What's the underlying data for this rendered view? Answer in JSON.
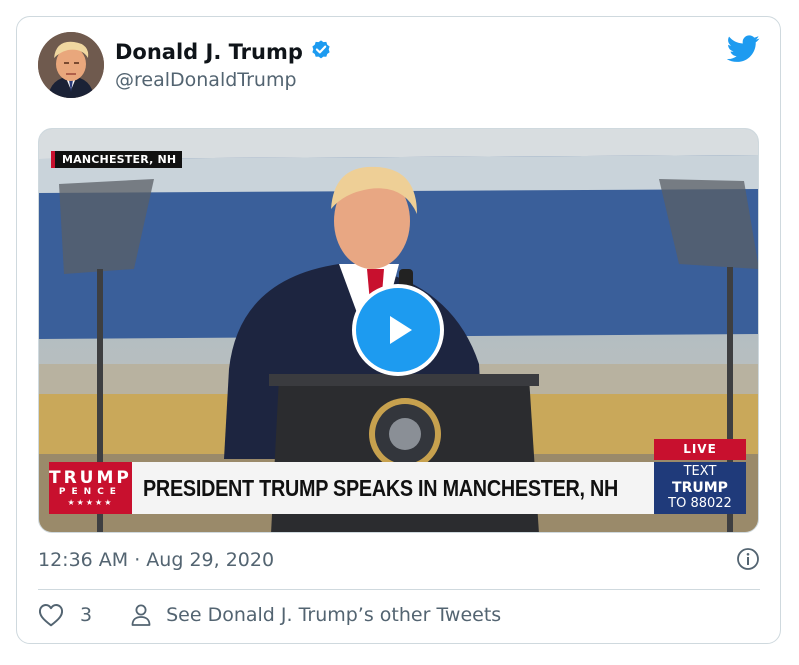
{
  "tweet": {
    "author_name": "Donald J. Trump",
    "handle": "@realDonaldTrump",
    "timestamp": "12:36 AM · Aug 29, 2020",
    "like_count": "3",
    "see_other_label": "See Donald J. Trump’s other Tweets",
    "colors": {
      "accent": "#1d9bf0",
      "muted": "#536471",
      "border": "#cfd9de"
    }
  },
  "video": {
    "location_tag": "MANCHESTER, NH",
    "brand_line1": "TRUMP",
    "brand_line2": "PENCE",
    "brand_line3": "★★★★★",
    "headline": "PRESIDENT TRUMP SPEAKS IN MANCHESTER, NH",
    "live_label": "LIVE",
    "text_line1": "TEXT",
    "text_line2": "TRUMP",
    "text_line3": "TO 88022",
    "colors": {
      "red": "#c8102e",
      "navy": "#1f3a7a"
    }
  },
  "icons": {
    "verified": "verified-badge-icon",
    "brand": "twitter-bird-icon",
    "play": "play-icon",
    "info": "info-icon",
    "like": "heart-icon",
    "person": "person-icon"
  }
}
